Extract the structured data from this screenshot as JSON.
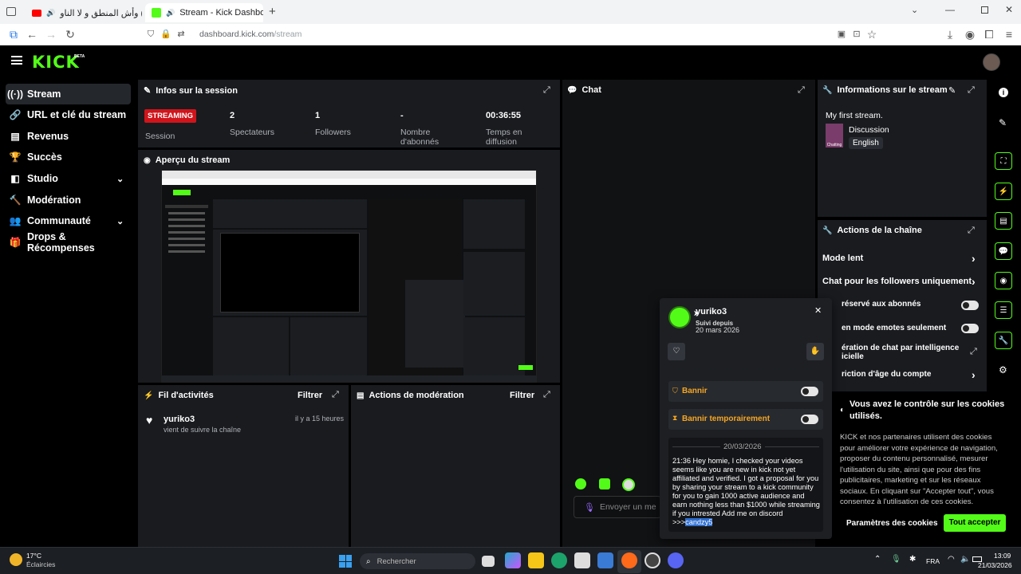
{
  "browser": {
    "tab1_title": "(438) وأش المنطق و لا الناو",
    "tab2_title": "Stream - Kick Dashboard",
    "url_domain": "dashboard.kick.com",
    "url_path": "/stream",
    "new_tab": "+"
  },
  "app": {
    "logo": "KICK",
    "logo_badge": "BETA"
  },
  "sidebar": {
    "items": [
      {
        "label": "Stream"
      },
      {
        "label": "URL et clé du stream"
      },
      {
        "label": "Revenus"
      },
      {
        "label": "Succès"
      },
      {
        "label": "Studio"
      },
      {
        "label": "Modération"
      },
      {
        "label": "Communauté"
      },
      {
        "label": "Drops & Récompenses"
      }
    ]
  },
  "session": {
    "title": "Infos sur la session",
    "status_badge": "STREAMING",
    "stats": [
      {
        "value": "",
        "label": "Session"
      },
      {
        "value": "2",
        "label": "Spectateurs"
      },
      {
        "value": "1",
        "label": "Followers"
      },
      {
        "value": "-",
        "label": "Nombre d'abonnés"
      },
      {
        "value": "00:36:55",
        "label": "Temps en diffusion"
      }
    ]
  },
  "preview": {
    "title": "Aperçu du stream"
  },
  "chat": {
    "title": "Chat",
    "input_placeholder": "Envoyer un me"
  },
  "stream_info": {
    "title": "Informations sur le stream",
    "stream_title": "My first stream.",
    "category": "Discussion",
    "language": "English",
    "thumb_text": "Chatting"
  },
  "channel_actions": {
    "title": "Actions de la chaîne",
    "items": [
      {
        "label": "Mode lent"
      },
      {
        "label": "Chat pour les followers uniquement"
      },
      {
        "label": "réservé aux abonnés"
      },
      {
        "label": "en mode emotes seulement"
      },
      {
        "label": "ération de chat par intelligence"
      },
      {
        "label": "icielle"
      },
      {
        "label": "riction d'âge du compte"
      }
    ]
  },
  "activity": {
    "title": "Fil d'activités",
    "filter": "Filtrer",
    "items": [
      {
        "user": "yuriko3",
        "action": "vient de suivre la chaîne",
        "time": "il y a 15 heures"
      }
    ]
  },
  "moderation": {
    "title": "Actions de modération",
    "filter": "Filtrer"
  },
  "user_card": {
    "username": "yuriko3",
    "followed_label": "Suivi depuis",
    "followed_date": "20 mars 2026",
    "ban_label": "Bannir",
    "timeout_label": "Bannir temporairement",
    "date_separator": "20/03/2026",
    "message": "21:36 Hey homie, I checked your videos seems like you are new in kick not yet affiliated and verified. I got a proposal for you by sharing your stream to a kick community for you to gain 1000 active audience and earn nothing less than $1000 while streaming if you intrested Add me on discord >>>",
    "message_highlight": "candzy5"
  },
  "cookies": {
    "title": "Vous avez le contrôle sur les cookies utilisés.",
    "body": "KICK et nos partenaires utilisent des cookies pour améliorer votre expérience de navigation, proposer du contenu personnalisé, mesurer l'utilisation du site, ainsi que pour des fins publicitaires, marketing et sur les réseaux sociaux. En cliquant sur \"Accepter tout\", vous consentez à l'utilisation de ces cookies.",
    "settings_button": "Paramètres des cookies",
    "accept_button": "Tout accepter"
  },
  "taskbar": {
    "temperature": "17°C",
    "weather": "Éclaircies",
    "search_placeholder": "Rechercher",
    "lang": "FRA",
    "time": "13:09",
    "date": "21/03/2026"
  },
  "colors": {
    "accent": "#53fc18",
    "danger": "#d0141b",
    "panel": "#191b1f",
    "highlight": "#2f6fd1",
    "ban": "#f5a623"
  }
}
